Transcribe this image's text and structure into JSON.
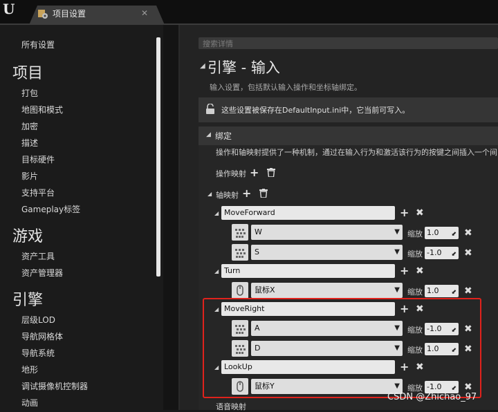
{
  "window": {
    "tab_title": "项目设置",
    "colors": {
      "highlight": "#e0221c",
      "panel": "#232323",
      "sidebar": "#1b1b1b"
    }
  },
  "sidebar": {
    "all_settings": "所有设置",
    "sections": [
      {
        "title": "项目",
        "items": [
          "打包",
          "地图和模式",
          "加密",
          "描述",
          "目标硬件",
          "影片",
          "支持平台",
          "Gameplay标签"
        ]
      },
      {
        "title": "游戏",
        "items": [
          "资产工具",
          "资产管理器"
        ]
      },
      {
        "title": "引擎",
        "items": [
          "层级LOD",
          "导航网格体",
          "导航系统",
          "地形",
          "调试摄像机控制器",
          "动画"
        ]
      }
    ]
  },
  "main": {
    "search_placeholder": "搜索详情",
    "title": "引擎 - 输入",
    "description": "输入设置，包括默认输入操作和坐标轴绑定。",
    "notice": "这些设置被保存在DefaultInput.ini中，它当前可写入。",
    "bindings": {
      "title": "绑定",
      "description": "操作和轴映射提供了一种机制，通过在输入行为和激活该行为的按键之间插入一个间",
      "action_mappings_label": "操作映射",
      "axis_mappings_label": "轴映射",
      "scale_label": "缩放",
      "axis_mappings": [
        {
          "name": "MoveForward",
          "keys": [
            {
              "key": "W",
              "scale": "1.0",
              "icon": "keyboard-icon"
            },
            {
              "key": "S",
              "scale": "-1.0",
              "icon": "keyboard-icon"
            }
          ]
        },
        {
          "name": "Turn",
          "keys": [
            {
              "key": "鼠标X",
              "scale": "1.0",
              "icon": "mouse-icon"
            }
          ]
        },
        {
          "name": "MoveRight",
          "keys": [
            {
              "key": "A",
              "scale": "-1.0",
              "icon": "keyboard-icon"
            },
            {
              "key": "D",
              "scale": "1.0",
              "icon": "keyboard-icon"
            }
          ]
        },
        {
          "name": "LookUp",
          "keys": [
            {
              "key": "鼠标Y",
              "scale": "-1.0",
              "icon": "mouse-icon"
            }
          ]
        }
      ],
      "voice_mappings_label": "语音映射"
    }
  },
  "watermark": "CSDN @Zhichao_97"
}
